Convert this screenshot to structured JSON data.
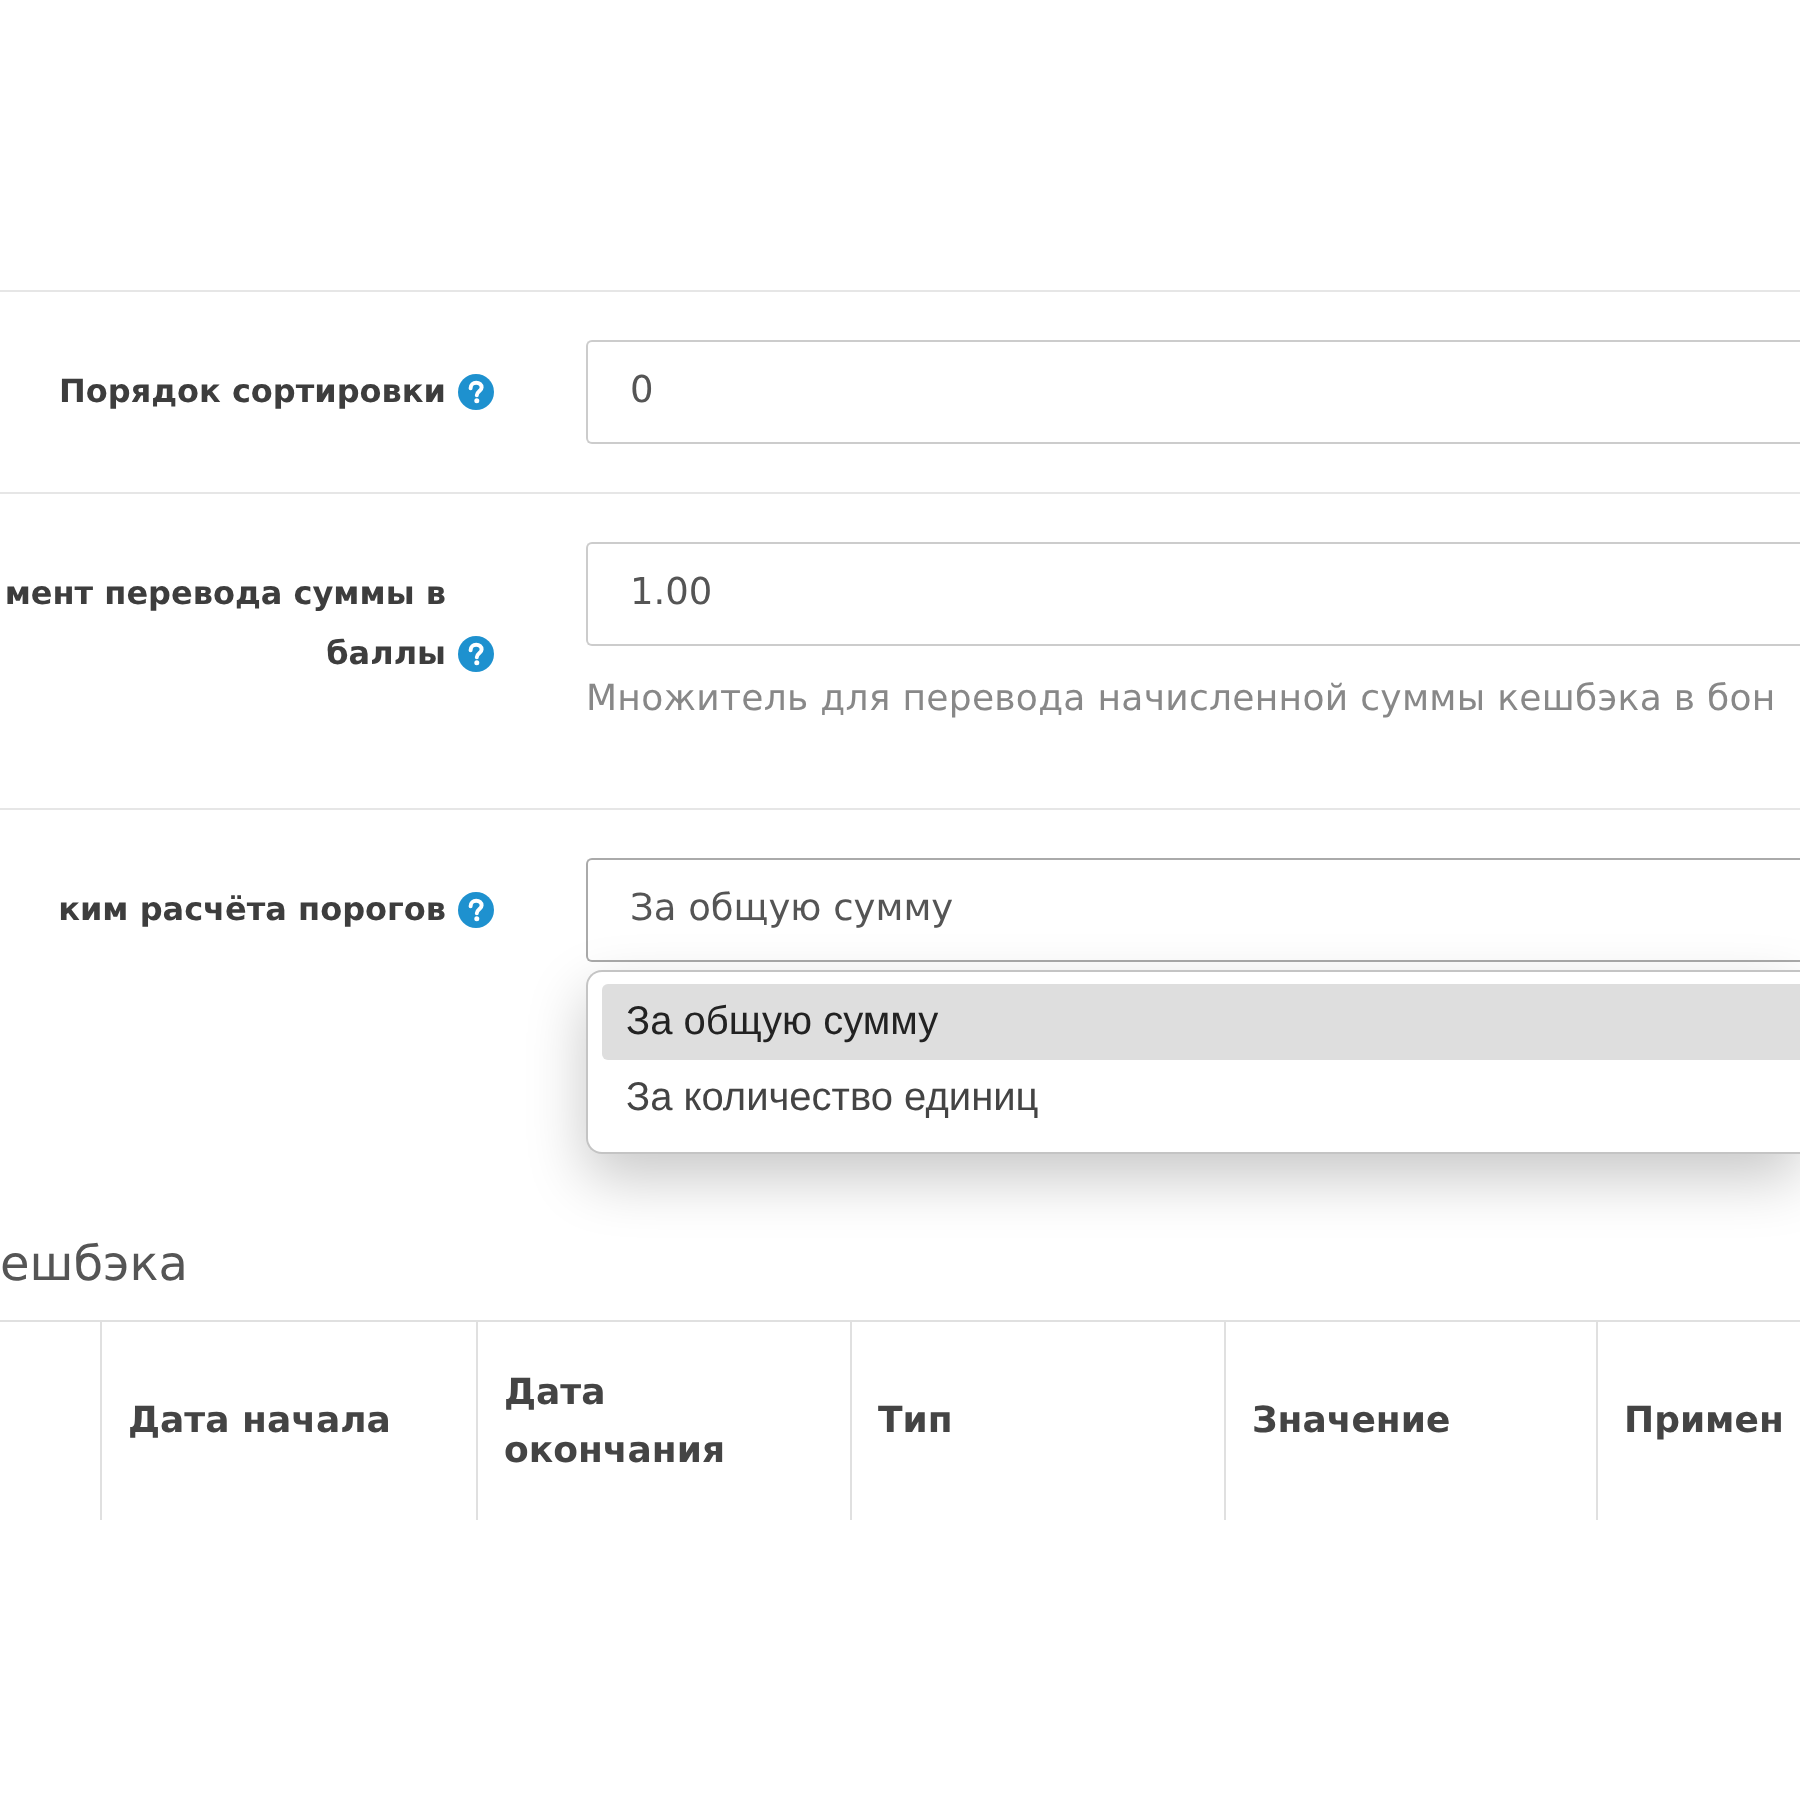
{
  "settings": [
    {
      "kind": "input",
      "label": "Порядок сортировки",
      "value": "0"
    },
    {
      "kind": "input",
      "label": "мент перевода суммы в баллы",
      "value": "1.00",
      "hint": "Множитель для перевода начисленной суммы кешбэка в бон"
    },
    {
      "kind": "select",
      "label": "ким расчёта порогов",
      "value": "За общую сумму",
      "expanded": true,
      "options": [
        {
          "label": "За общую сумму",
          "selected": true
        },
        {
          "label": "За количество единиц",
          "selected": false
        }
      ]
    }
  ],
  "section": {
    "title": "ешбэка",
    "table": {
      "columns": [
        "Дата начала",
        "Дата окончания",
        "Тип",
        "Значение",
        "Примен"
      ]
    }
  }
}
